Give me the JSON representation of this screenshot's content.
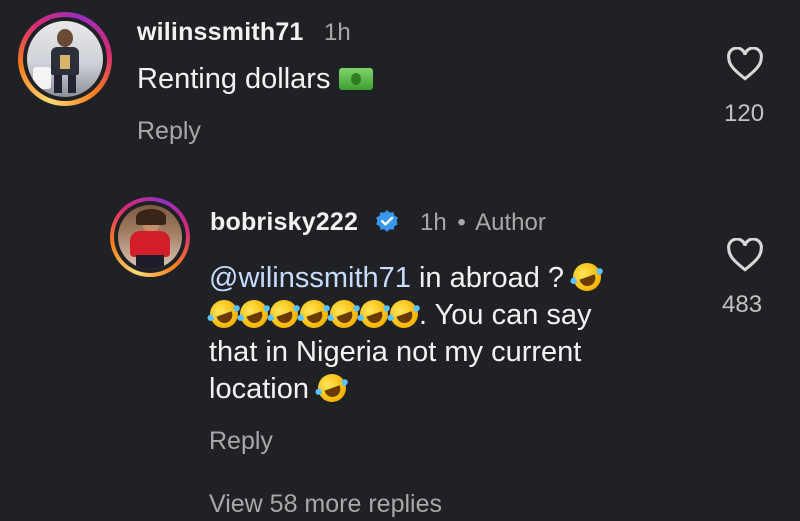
{
  "comment": {
    "username": "wilinssmith71",
    "time": "1h",
    "text": "Renting dollars",
    "text_emoji": "dollar-banknote-icon",
    "reply_label": "Reply",
    "like_count": "120"
  },
  "reply": {
    "username": "bobrisky222",
    "time": "1h",
    "separator": "•",
    "author_label": "Author",
    "verified_icon": "verified-badge-icon",
    "mention": "@wilinssmith71",
    "line1_text": " in abroad ? ",
    "line2_text": ". You can say",
    "line3_text": "that in Nigeria not my current",
    "line4_text": "location ",
    "emoji_icon": "rolling-on-floor-laughing-icon",
    "reply_label": "Reply",
    "like_count": "483"
  },
  "view_more_label": "View 58 more replies",
  "colors": {
    "background": "#202124",
    "secondary_text": "#a8a8a8",
    "verified_blue": "#3897f0",
    "mention": "#c7dcff"
  }
}
